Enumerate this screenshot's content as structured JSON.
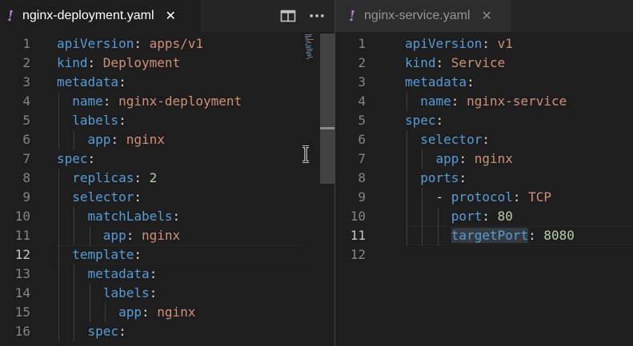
{
  "left_editor": {
    "tab": {
      "icon": "yaml-warning-icon",
      "glyph": "!",
      "title": "nginx-deployment.yaml",
      "close_glyph": "✕"
    },
    "actions": {
      "split_icon": "split-editor-icon",
      "more_icon": "more-actions-icon",
      "more_glyph": "···"
    },
    "current_line": 12,
    "lines": [
      {
        "num": "1",
        "tokens": [
          {
            "t": "apiVersion",
            "c": "k"
          },
          {
            "t": ": ",
            "c": "p"
          },
          {
            "t": "apps/v1",
            "c": "s"
          }
        ]
      },
      {
        "num": "2",
        "tokens": [
          {
            "t": "kind",
            "c": "k"
          },
          {
            "t": ": ",
            "c": "p"
          },
          {
            "t": "Deployment",
            "c": "s"
          }
        ]
      },
      {
        "num": "3",
        "tokens": [
          {
            "t": "metadata",
            "c": "k"
          },
          {
            "t": ":",
            "c": "p"
          }
        ]
      },
      {
        "num": "4",
        "tokens": [
          {
            "t": "  ",
            "c": "p"
          },
          {
            "t": "name",
            "c": "k"
          },
          {
            "t": ": ",
            "c": "p"
          },
          {
            "t": "nginx-deployment",
            "c": "s"
          }
        ]
      },
      {
        "num": "5",
        "tokens": [
          {
            "t": "  ",
            "c": "p"
          },
          {
            "t": "labels",
            "c": "k"
          },
          {
            "t": ":",
            "c": "p"
          }
        ]
      },
      {
        "num": "6",
        "tokens": [
          {
            "t": "    ",
            "c": "p"
          },
          {
            "t": "app",
            "c": "k"
          },
          {
            "t": ": ",
            "c": "p"
          },
          {
            "t": "nginx",
            "c": "s"
          }
        ]
      },
      {
        "num": "7",
        "tokens": [
          {
            "t": "spec",
            "c": "k"
          },
          {
            "t": ":",
            "c": "p"
          }
        ]
      },
      {
        "num": "8",
        "tokens": [
          {
            "t": "  ",
            "c": "p"
          },
          {
            "t": "replicas",
            "c": "k"
          },
          {
            "t": ": ",
            "c": "p"
          },
          {
            "t": "2",
            "c": "n"
          }
        ]
      },
      {
        "num": "9",
        "tokens": [
          {
            "t": "  ",
            "c": "p"
          },
          {
            "t": "selector",
            "c": "k"
          },
          {
            "t": ":",
            "c": "p"
          }
        ]
      },
      {
        "num": "10",
        "tokens": [
          {
            "t": "    ",
            "c": "p"
          },
          {
            "t": "matchLabels",
            "c": "k"
          },
          {
            "t": ":",
            "c": "p"
          }
        ]
      },
      {
        "num": "11",
        "tokens": [
          {
            "t": "      ",
            "c": "p"
          },
          {
            "t": "app",
            "c": "k"
          },
          {
            "t": ": ",
            "c": "p"
          },
          {
            "t": "nginx",
            "c": "s"
          }
        ]
      },
      {
        "num": "12",
        "tokens": [
          {
            "t": "  ",
            "c": "p"
          },
          {
            "t": "template",
            "c": "k"
          },
          {
            "t": ":",
            "c": "p"
          }
        ]
      },
      {
        "num": "13",
        "tokens": [
          {
            "t": "    ",
            "c": "p"
          },
          {
            "t": "metadata",
            "c": "k"
          },
          {
            "t": ":",
            "c": "p"
          }
        ]
      },
      {
        "num": "14",
        "tokens": [
          {
            "t": "      ",
            "c": "p"
          },
          {
            "t": "labels",
            "c": "k"
          },
          {
            "t": ":",
            "c": "p"
          }
        ]
      },
      {
        "num": "15",
        "tokens": [
          {
            "t": "        ",
            "c": "p"
          },
          {
            "t": "app",
            "c": "k"
          },
          {
            "t": ": ",
            "c": "p"
          },
          {
            "t": "nginx",
            "c": "s"
          }
        ]
      },
      {
        "num": "16",
        "tokens": [
          {
            "t": "    ",
            "c": "p"
          },
          {
            "t": "spec",
            "c": "k"
          },
          {
            "t": ":",
            "c": "p"
          }
        ]
      }
    ]
  },
  "right_editor": {
    "tab": {
      "icon": "yaml-warning-icon",
      "glyph": "!",
      "title": "nginx-service.yaml",
      "close_glyph": "✕"
    },
    "current_line": 11,
    "lines": [
      {
        "num": "1",
        "tokens": [
          {
            "t": "apiVersion",
            "c": "k"
          },
          {
            "t": ": ",
            "c": "p"
          },
          {
            "t": "v1",
            "c": "s"
          }
        ]
      },
      {
        "num": "2",
        "tokens": [
          {
            "t": "kind",
            "c": "k"
          },
          {
            "t": ": ",
            "c": "p"
          },
          {
            "t": "Service",
            "c": "s"
          }
        ]
      },
      {
        "num": "3",
        "tokens": [
          {
            "t": "metadata",
            "c": "k"
          },
          {
            "t": ":",
            "c": "p"
          }
        ]
      },
      {
        "num": "4",
        "tokens": [
          {
            "t": "  ",
            "c": "p"
          },
          {
            "t": "name",
            "c": "k"
          },
          {
            "t": ": ",
            "c": "p"
          },
          {
            "t": "nginx-service",
            "c": "s"
          }
        ]
      },
      {
        "num": "5",
        "tokens": [
          {
            "t": "spec",
            "c": "k"
          },
          {
            "t": ":",
            "c": "p"
          }
        ]
      },
      {
        "num": "6",
        "tokens": [
          {
            "t": "  ",
            "c": "p"
          },
          {
            "t": "selector",
            "c": "k"
          },
          {
            "t": ":",
            "c": "p"
          }
        ]
      },
      {
        "num": "7",
        "tokens": [
          {
            "t": "    ",
            "c": "p"
          },
          {
            "t": "app",
            "c": "k"
          },
          {
            "t": ": ",
            "c": "p"
          },
          {
            "t": "nginx",
            "c": "s"
          }
        ]
      },
      {
        "num": "8",
        "tokens": [
          {
            "t": "  ",
            "c": "p"
          },
          {
            "t": "ports",
            "c": "k"
          },
          {
            "t": ":",
            "c": "p"
          }
        ]
      },
      {
        "num": "9",
        "tokens": [
          {
            "t": "    ",
            "c": "p"
          },
          {
            "t": "- ",
            "c": "p"
          },
          {
            "t": "protocol",
            "c": "k"
          },
          {
            "t": ": ",
            "c": "p"
          },
          {
            "t": "TCP",
            "c": "s"
          }
        ]
      },
      {
        "num": "10",
        "tokens": [
          {
            "t": "      ",
            "c": "p"
          },
          {
            "t": "port",
            "c": "k"
          },
          {
            "t": ": ",
            "c": "p"
          },
          {
            "t": "80",
            "c": "n"
          }
        ]
      },
      {
        "num": "11",
        "tokens": [
          {
            "t": "      ",
            "c": "p"
          },
          {
            "t": "targetPort",
            "c": "k",
            "hl": true
          },
          {
            "t": ": ",
            "c": "p"
          },
          {
            "t": "8080",
            "c": "n"
          }
        ]
      },
      {
        "num": "12",
        "tokens": []
      }
    ]
  },
  "colors": {
    "editor_background": "#1e1e1e",
    "tab_inactive_background": "#2d2d2d",
    "yaml_key": "#569cd6",
    "yaml_string": "#ce9178",
    "yaml_number": "#b5cea8",
    "punctuation": "#d4d4d4",
    "line_number": "#858585",
    "line_number_active": "#c6c6c6",
    "file_icon": "#b180d7"
  }
}
